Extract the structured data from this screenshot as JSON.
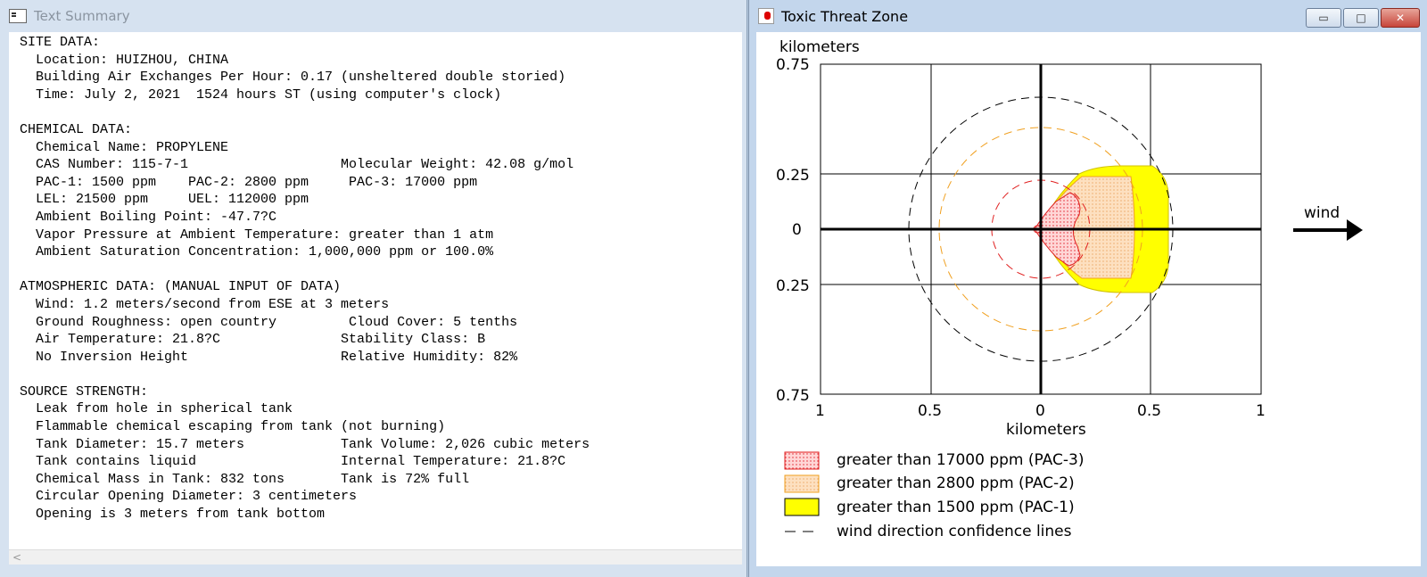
{
  "text_window": {
    "title": "Text Summary",
    "lines": [
      "SITE DATA:",
      "  Location: HUIZHOU, CHINA",
      "  Building Air Exchanges Per Hour: 0.17 (unsheltered double storied)",
      "  Time: July 2, 2021  1524 hours ST (using computer's clock)",
      "",
      "CHEMICAL DATA:",
      "  Chemical Name: PROPYLENE",
      "  CAS Number: 115-7-1                   Molecular Weight: 42.08 g/mol",
      "  PAC-1: 1500 ppm    PAC-2: 2800 ppm     PAC-3: 17000 ppm",
      "  LEL: 21500 ppm     UEL: 112000 ppm",
      "  Ambient Boiling Point: -47.7?C",
      "  Vapor Pressure at Ambient Temperature: greater than 1 atm",
      "  Ambient Saturation Concentration: 1,000,000 ppm or 100.0%",
      "",
      "ATMOSPHERIC DATA: (MANUAL INPUT OF DATA)",
      "  Wind: 1.2 meters/second from ESE at 3 meters",
      "  Ground Roughness: open country         Cloud Cover: 5 tenths",
      "  Air Temperature: 21.8?C               Stability Class: B",
      "  No Inversion Height                   Relative Humidity: 82%",
      "",
      "SOURCE STRENGTH:",
      "  Leak from hole in spherical tank",
      "  Flammable chemical escaping from tank (not burning)",
      "  Tank Diameter: 15.7 meters            Tank Volume: 2,026 cubic meters",
      "  Tank contains liquid                  Internal Temperature: 21.8?C",
      "  Chemical Mass in Tank: 832 tons       Tank is 72% full",
      "  Circular Opening Diameter: 3 centimeters",
      "  Opening is 3 meters from tank bottom"
    ],
    "scroll_left_arrow": "<"
  },
  "plot_window": {
    "title": "Toxic Threat Zone",
    "buttons": {
      "minimize": "▭",
      "maximize": "□",
      "close": "✕"
    },
    "y_axis_title": "kilometers",
    "x_axis_title": "kilometers",
    "y_tick_labels": [
      "0.75",
      "0.25",
      "0",
      "0.25",
      "0.75"
    ],
    "x_tick_labels": [
      "1",
      "0.5",
      "0",
      "0.5",
      "1"
    ],
    "wind_label": "wind",
    "legend": [
      {
        "label": "greater than 17000 ppm (PAC-3)",
        "swatch": "dotted-red"
      },
      {
        "label": "greater than 2800 ppm (PAC-2)",
        "swatch": "dotted-orange"
      },
      {
        "label": "greater than 1500 ppm (PAC-1)",
        "swatch": "yellow"
      },
      {
        "label": "wind direction confidence lines",
        "swatch": "dashed-line"
      }
    ],
    "colors": {
      "pac3_fill": "#ffd6d6",
      "pac3_dots": "#e0202a",
      "pac2_fill": "#fde0c0",
      "pac2_dots": "#e89040",
      "pac1_fill": "#ffff00",
      "confidence_outer": "#000000",
      "confidence_pac2": "#f0a020",
      "confidence_pac3": "#e02020"
    }
  }
}
